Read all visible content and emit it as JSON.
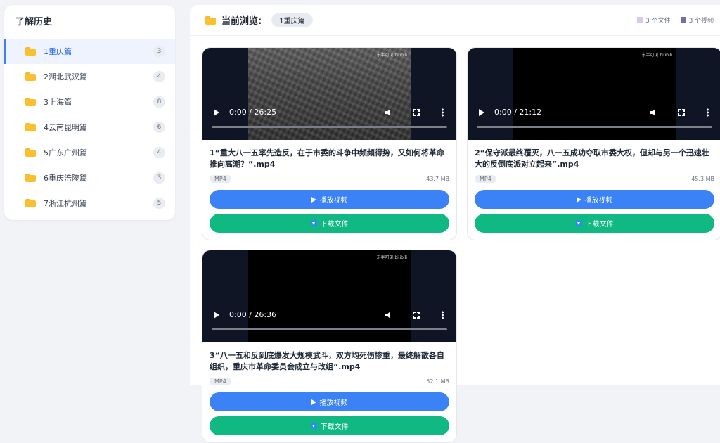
{
  "sidebar": {
    "title": "了解历史",
    "items": [
      {
        "label": "1重庆篇",
        "count": "3",
        "active": true
      },
      {
        "label": "2湖北武汉篇",
        "count": "4"
      },
      {
        "label": "3上海篇",
        "count": "8"
      },
      {
        "label": "4云南昆明篇",
        "count": "6"
      },
      {
        "label": "5广东广州篇",
        "count": "4"
      },
      {
        "label": "6重庆涪陵篇",
        "count": "3"
      },
      {
        "label": "7浙江杭州篇",
        "count": "5"
      }
    ]
  },
  "header": {
    "label": "当前浏览:",
    "current": "1重庆篇",
    "file_count": "3 个文件",
    "video_count": "3 个视频"
  },
  "cards": [
    {
      "time": "0:00 / 26:25",
      "watermark": "东半可见 bilibili",
      "title": "1“重大八一五率先造反，在于市委的斗争中频频得势，又如何将革命推向高潮？”.mp4",
      "format": "MP4",
      "size": "43.7 MB",
      "play_label": "播放视频",
      "download_label": "下载文件"
    },
    {
      "time": "0:00 / 21:12",
      "watermark": "东半可见 bilibili",
      "title": "2“保守派最终覆灭，八一五成功夺取市委大权，但却与另一个迅速壮大的反倒底派对立起来”.mp4",
      "format": "MP4",
      "size": "45.3 MB",
      "play_label": "播放视频",
      "download_label": "下载文件"
    },
    {
      "time": "0:00 / 26:36",
      "watermark": "东半可见 bilibili",
      "title": "3“八一五和反到底爆发大规模武斗，双方均死伤惨重，最终解散各自组织，重庆市革命委员会成立与改组”.mp4",
      "format": "MP4",
      "size": "52.1 MB",
      "play_label": "播放视频",
      "download_label": "下载文件"
    }
  ]
}
